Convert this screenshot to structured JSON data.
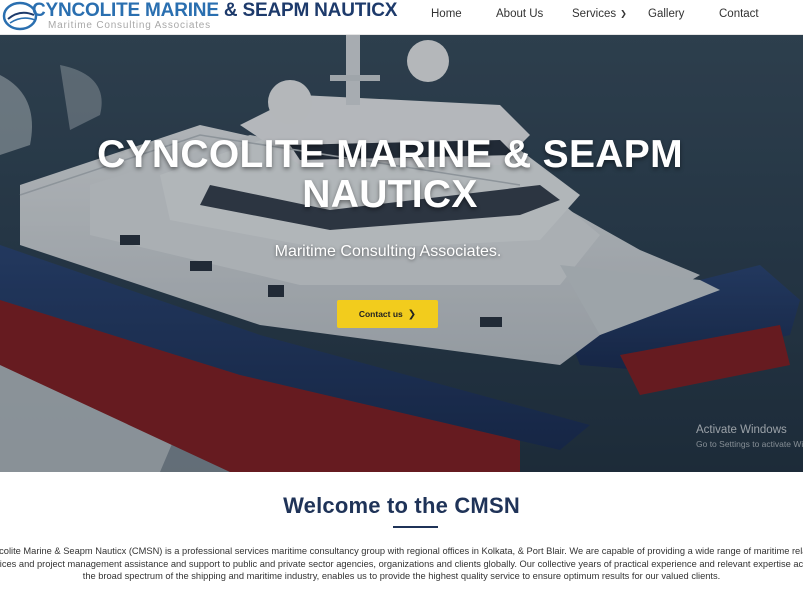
{
  "header": {
    "logo_title_part1": "CYNCOLITE MARINE",
    "logo_title_amp": " & ",
    "logo_title_part2": "SEAPM NAUTICX",
    "logo_tagline": "Maritime Consulting Associates",
    "nav": {
      "home": "Home",
      "about": "About Us",
      "services": "Services",
      "gallery": "Gallery",
      "contact": "Contact"
    }
  },
  "hero": {
    "title_line1": "CYNCOLITE MARINE & SEAPM",
    "title_line2": "NAUTICX",
    "subtitle": "Maritime Consulting Associates.",
    "cta_label": "Contact us"
  },
  "os_watermark": {
    "title": "Activate Windows",
    "subtitle": "Go to Settings to activate Windows."
  },
  "welcome": {
    "title": "Welcome to the CMSN",
    "body": "Cyncolite Marine & Seapm Nauticx (CMSN) is a professional services maritime consultancy group with regional offices in Kolkata, & Port Blair. We are capable of providing a wide range of maritime related services and project management assistance and support to public and private sector agencies, organizations and clients globally. Our collective years of practical experience and relevant expertise across the broad spectrum of the shipping and maritime industry, enables us to provide the highest quality service to ensure optimum results for our valued clients."
  },
  "colors": {
    "brand_blue": "#2a6fb0",
    "brand_navy": "#1f3358",
    "cta_yellow": "#f2cc1d"
  }
}
